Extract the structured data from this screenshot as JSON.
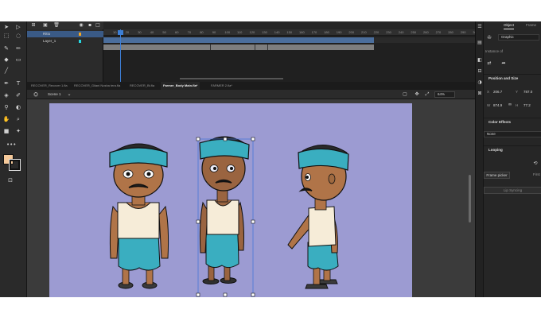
{
  "timeline": {
    "layers": [
      {
        "name": "Ritto",
        "selected": true,
        "color": "#f5a623"
      },
      {
        "name": "Layer_1",
        "selected": false,
        "color": "#26d6e0"
      }
    ],
    "ruler_ticks": [
      "10",
      "15",
      "20",
      "25",
      "30",
      "35",
      "40",
      "45",
      "50",
      "55",
      "60",
      "65",
      "70",
      "75",
      "80",
      "85",
      "90",
      "95",
      "100",
      "105",
      "110",
      "115",
      "120",
      "125",
      "130",
      "135",
      "140",
      "145",
      "150",
      "155",
      "160",
      "165",
      "170",
      "175",
      "180",
      "185",
      "190",
      "195",
      "200",
      "205",
      "210",
      "215",
      "220",
      "225",
      "230",
      "235",
      "240",
      "245",
      "250",
      "255",
      "260",
      "265",
      "270",
      "275",
      "280",
      "285",
      "290",
      "295",
      "300"
    ]
  },
  "document_tabs": [
    {
      "label": "RECOVER_Recover 1.fla",
      "active": false
    },
    {
      "label": "RECOVER_Gilani Nosha tera.fla",
      "active": false
    },
    {
      "label": "RECOVER_Bt.fla",
      "active": false
    },
    {
      "label": "Farmer_Body Main.fla*",
      "active": true
    },
    {
      "label": "FARMER 2.fla*",
      "active": false
    }
  ],
  "scene": {
    "label": "Scene 1",
    "zoom": "64%"
  },
  "properties": {
    "tabs": [
      {
        "label": "Object",
        "active": true
      },
      {
        "label": "Frame",
        "active": false
      }
    ],
    "symbol_type": "Graphic",
    "instance_of_label": "Instance of",
    "position_size_title": "Position and Size",
    "x_label": "X",
    "x_value": "206.7",
    "y_label": "Y",
    "y_value": "787.0",
    "w_label": "W",
    "w_value": "874.9",
    "h_label": "H",
    "h_value": "77.2",
    "color_effects_title": "Color Effects",
    "color_effect_value": "None",
    "looping_title": "Looping",
    "frame_picker_label": "Frame picker",
    "first_label": "First",
    "lip_syncing_label": "Lip Syncing"
  },
  "colors": {
    "stage": "#9c9bd2",
    "fill_swatch": "#f5c99a",
    "accent": "#3d7fd6",
    "headband": "#3aaec0",
    "skin": "#b07448"
  }
}
